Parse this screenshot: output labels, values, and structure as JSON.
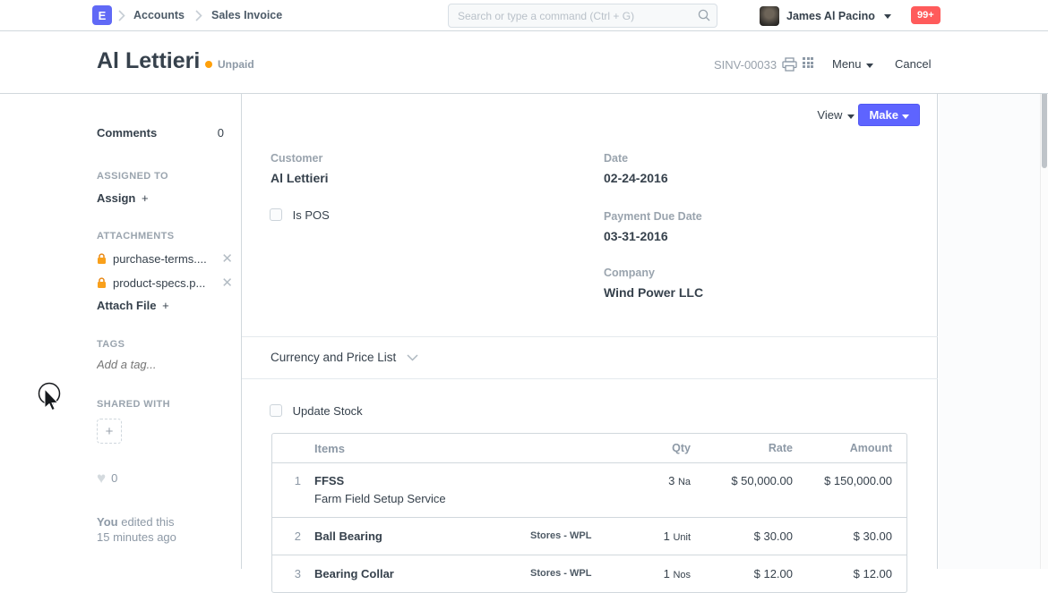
{
  "navbar": {
    "logo_letter": "E",
    "breadcrumbs": [
      "Accounts",
      "Sales Invoice"
    ],
    "search_placeholder": "Search or type a command (Ctrl + G)",
    "user_name": "James Al Pacino",
    "badge": "99+"
  },
  "page_head": {
    "title": "Al Lettieri",
    "status": "Unpaid",
    "doc_id": "SINV-00033",
    "menu": "Menu",
    "cancel": "Cancel"
  },
  "actions": {
    "view": "View",
    "make": "Make"
  },
  "sidebar": {
    "comments_label": "Comments",
    "comments_count": "0",
    "assigned_heading": "ASSIGNED TO",
    "assign": "Assign",
    "attachments_heading": "ATTACHMENTS",
    "attachments": [
      {
        "name": "purchase-terms...."
      },
      {
        "name": "product-specs.p..."
      }
    ],
    "attach_file": "Attach File",
    "tags_heading": "TAGS",
    "tag_placeholder": "Add a tag...",
    "shared_heading": "SHARED WITH",
    "likes": "0",
    "edited_by": "You",
    "edited_text": "edited this",
    "edited_time": "15 minutes ago"
  },
  "form": {
    "customer_label": "Customer",
    "customer_value": "Al Lettieri",
    "is_pos": "Is POS",
    "date_label": "Date",
    "date_value": "02-24-2016",
    "due_label": "Payment Due Date",
    "due_value": "03-31-2016",
    "company_label": "Company",
    "company_value": "Wind Power LLC",
    "currency_section": "Currency and Price List",
    "update_stock": "Update Stock"
  },
  "table": {
    "headers": {
      "items": "Items",
      "qty": "Qty",
      "rate": "Rate",
      "amount": "Amount"
    },
    "rows": [
      {
        "idx": "1",
        "item": "FFSS",
        "desc": "Farm Field Setup Service",
        "warehouse": "",
        "qty": "3",
        "uom": "Na",
        "rate": "$ 50,000.00",
        "amount": "$ 150,000.00"
      },
      {
        "idx": "2",
        "item": "Ball Bearing",
        "desc": "",
        "warehouse": "Stores - WPL",
        "qty": "1",
        "uom": "Unit",
        "rate": "$ 30.00",
        "amount": "$ 30.00"
      },
      {
        "idx": "3",
        "item": "Bearing Collar",
        "desc": "",
        "warehouse": "Stores - WPL",
        "qty": "1",
        "uom": "Nos",
        "rate": "$ 12.00",
        "amount": "$ 12.00"
      }
    ]
  },
  "colors": {
    "accent_blue": "#5e64ff",
    "badge_red": "#ff5b5b",
    "status_orange": "#ffa00a",
    "text_dark": "#36414c",
    "text_muted": "#8d99a6",
    "border": "#d1d8dd"
  }
}
